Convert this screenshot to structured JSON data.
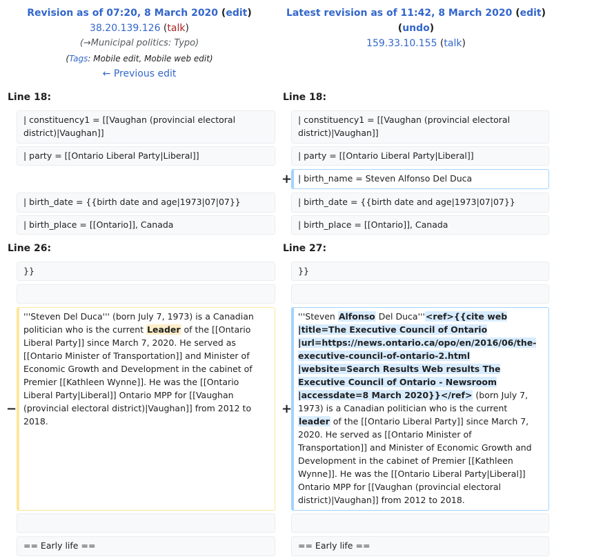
{
  "old": {
    "title_prefix": "Revision as of 07:20, 8 March 2020",
    "edit": "edit",
    "user": "38.20.139.126",
    "talk": "talk",
    "summary_arrow": "(→",
    "summary_section": "Municipal politics",
    "summary_rest": ": Typo)",
    "tags_open": "(",
    "tags_link": "Tags",
    "tags_rest": ": Mobile edit, Mobile web edit)",
    "prev_edit": "← Previous edit"
  },
  "new": {
    "title_prefix": "Latest revision as of 11:42, 8 March 2020",
    "edit": "edit",
    "undo": "undo",
    "user": "159.33.10.155",
    "talk": "talk"
  },
  "line_labels": {
    "left_1": "Line 18:",
    "right_1": "Line 18:",
    "left_2": "Line 26:",
    "right_2": "Line 27:"
  },
  "rows": {
    "constituency": "| constituency1 = [[Vaughan (provincial electoral district)|Vaughan]]",
    "party": "| party = [[Ontario Liberal Party|Liberal]]",
    "birth_name": "| birth_name = Steven Alfonso Del Duca",
    "birth_date": "| birth_date = {{birth date and age|1973|07|07}}",
    "birth_place": "| birth_place = [[Ontario]], Canada",
    "closing": "}}",
    "early_life": "== Early life =="
  },
  "old_para": {
    "before": "'''Steven Del Duca''' (born July 7, 1973) is a Canadian politician who is the current ",
    "changed": "Leader",
    "after": " of the [[Ontario Liberal Party]] since March 7, 2020. He served as [[Ontario Minister of Transportation]] and Minister of Economic Growth and Development in the cabinet of Premier [[Kathleen Wynne]]. He was the [[Ontario Liberal Party|Liberal]] Ontario MPP for [[Vaughan (provincial electoral district)|Vaughan]] from 2012 to 2018."
  },
  "new_para": {
    "p1": "'''Steven ",
    "h1": "Alfonso",
    "p2": " Del Duca'''",
    "h2": "<ref>{{cite web |title=The Executive Council of Ontario |url=https://news.ontario.ca/opo/en/2016/06/the-executive-council-of-ontario-2.html |website=Search Results Web results  The Executive Council of Ontario - Newsroom |accessdate=8 March 2020}}</ref>",
    "p3": " (born July 7, 1973) is a Canadian politician who is the current ",
    "h3": "leader",
    "p4": " of the [[Ontario Liberal Party]] since March 7, 2020. He served as [[Ontario Minister of Transportation]] and Minister of Economic Growth and Development in the cabinet of Premier [[Kathleen Wynne]]. He was the [[Ontario Liberal Party|Liberal]] Ontario MPP for [[Vaughan (provincial electoral district)|Vaughan]] from 2012 to 2018."
  },
  "markers": {
    "plus": "+",
    "minus": "−"
  }
}
